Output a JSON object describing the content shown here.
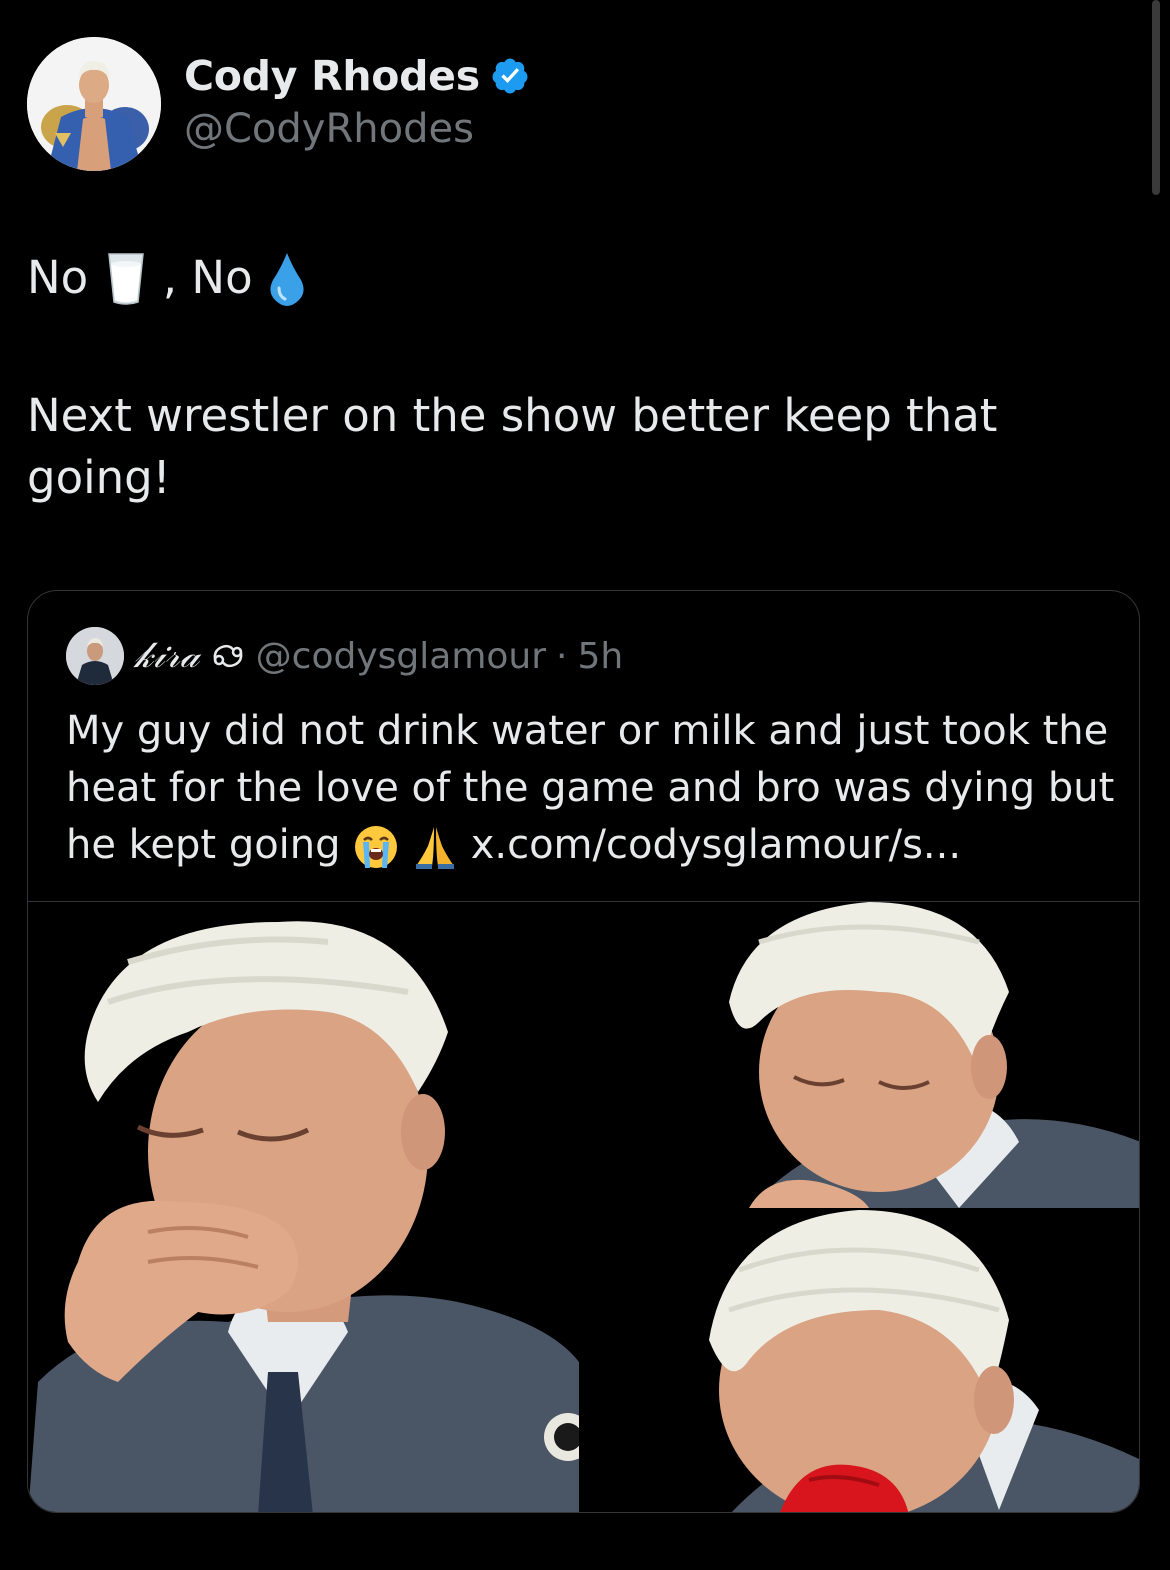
{
  "tweet": {
    "author": {
      "display_name": "Cody Rhodes",
      "handle": "@CodyRhodes",
      "verified": true,
      "avatar_icon": "profile-photo"
    },
    "text_line1": {
      "part1": "No ",
      "emoji1": "milk-glass-emoji",
      "part2": " , No ",
      "emoji2": "droplet-emoji"
    },
    "text_line2": "Next wrestler on the show better keep that going!"
  },
  "quoted_tweet": {
    "display_name": "𝓀𝒾𝓇𝒶",
    "display_name_plain": "kira",
    "name_decoration_icon": "cancer-zodiac-icon",
    "handle": "@codysglamour",
    "separator": "·",
    "time": "5h",
    "text": "My guy did not drink water or milk and just took the heat for the love of the game and bro was dying but he kept going",
    "emojis": [
      "loudly-crying-face-emoji",
      "folded-hands-emoji"
    ],
    "link": "x.com/codysglamour/s...",
    "media": [
      {
        "name": "photo-coughing"
      },
      {
        "name": "photo-head-down"
      },
      {
        "name": "photo-red-cloth"
      }
    ]
  },
  "colors": {
    "background": "#000000",
    "text": "#e7e9ea",
    "secondary": "#71767b",
    "verified_blue": "#1d9bf0",
    "border": "#333639"
  }
}
